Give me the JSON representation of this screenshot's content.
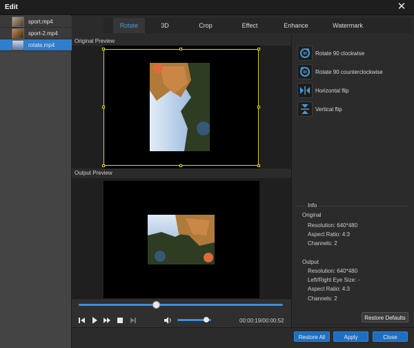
{
  "window": {
    "title": "Edit",
    "close_glyph": "✕"
  },
  "files": [
    {
      "name": "sport.mp4",
      "selected": false,
      "thumb_color": "#7a6a58"
    },
    {
      "name": "sport-2.mp4",
      "selected": false,
      "thumb_color": "#8a5a3a"
    },
    {
      "name": "rotate.mp4",
      "selected": true,
      "thumb_color": "#5a7aa8"
    }
  ],
  "tabs": [
    {
      "label": "Rotate",
      "active": true
    },
    {
      "label": "3D",
      "active": false
    },
    {
      "label": "Crop",
      "active": false
    },
    {
      "label": "Effect",
      "active": false
    },
    {
      "label": "Enhance",
      "active": false
    },
    {
      "label": "Watermark",
      "active": false
    }
  ],
  "preview": {
    "original_label": "Original Preview",
    "output_label": "Output Preview"
  },
  "rotate_actions": [
    {
      "label": "Rotate 90 clockwise",
      "icon": "rotate-cw-icon"
    },
    {
      "label": "Rotate 90 counterclockwise",
      "icon": "rotate-ccw-icon"
    },
    {
      "label": "Horizontal flip",
      "icon": "horizontal-flip-icon"
    },
    {
      "label": "Vertical flip",
      "icon": "vertical-flip-icon"
    }
  ],
  "info": {
    "title": "Info",
    "original_heading": "Original",
    "original": {
      "resolution": "Resolution: 640*480",
      "aspect": "Aspect Ratio: 4:3",
      "channels": "Channels: 2"
    },
    "output_heading": "Output",
    "output": {
      "resolution": "Resolution: 640*480",
      "eye_size": "Left/Right Eye Size: -",
      "aspect": "Aspect Ratio: 4:3",
      "channels": "Channels: 2"
    }
  },
  "player": {
    "progress": 0.38,
    "volume": 0.85,
    "timecode": "00:00:19/00:00:52"
  },
  "buttons": {
    "restore_defaults": "Restore Defaults",
    "restore_all": "Restore All",
    "apply": "Apply",
    "close": "Close"
  },
  "colors": {
    "accent": "#3d9de3",
    "selection": "#2f7fcf",
    "crop_box": "#e6e000"
  }
}
